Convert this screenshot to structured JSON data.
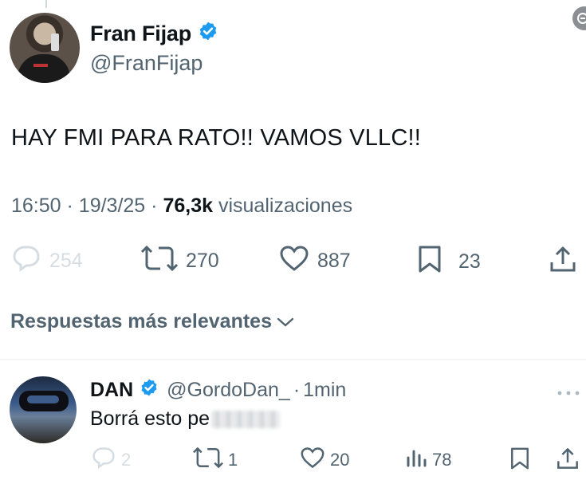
{
  "tweet": {
    "author_name": "Fran Fijap",
    "author_handle": "@FranFijap",
    "text": "HAY FMI PARA RATO!! VAMOS VLLC!!",
    "time": "16:50",
    "separator": "·",
    "date": "19/3/25",
    "views_count": "76,3k",
    "views_label": "visualizaciones",
    "replies": "254",
    "reposts": "270",
    "likes": "887",
    "bookmarks": "23"
  },
  "replies_section": {
    "sort_label": "Respuestas más relevantes"
  },
  "reply": {
    "author_name": "DAN",
    "author_handle": "@GordoDan_",
    "separator": "·",
    "time": "1min",
    "text": "Borrá esto pe",
    "replies": "2",
    "reposts": "1",
    "likes": "20",
    "views": "78"
  },
  "colors": {
    "verified_blue": "#1d9bf0",
    "text_primary": "#0f1419",
    "text_secondary": "#536471"
  },
  "icons": [
    "verified-badge-icon",
    "reply-icon",
    "repost-icon",
    "like-icon",
    "bookmark-icon",
    "share-icon",
    "chevron-down-icon",
    "more-icon",
    "views-icon"
  ]
}
